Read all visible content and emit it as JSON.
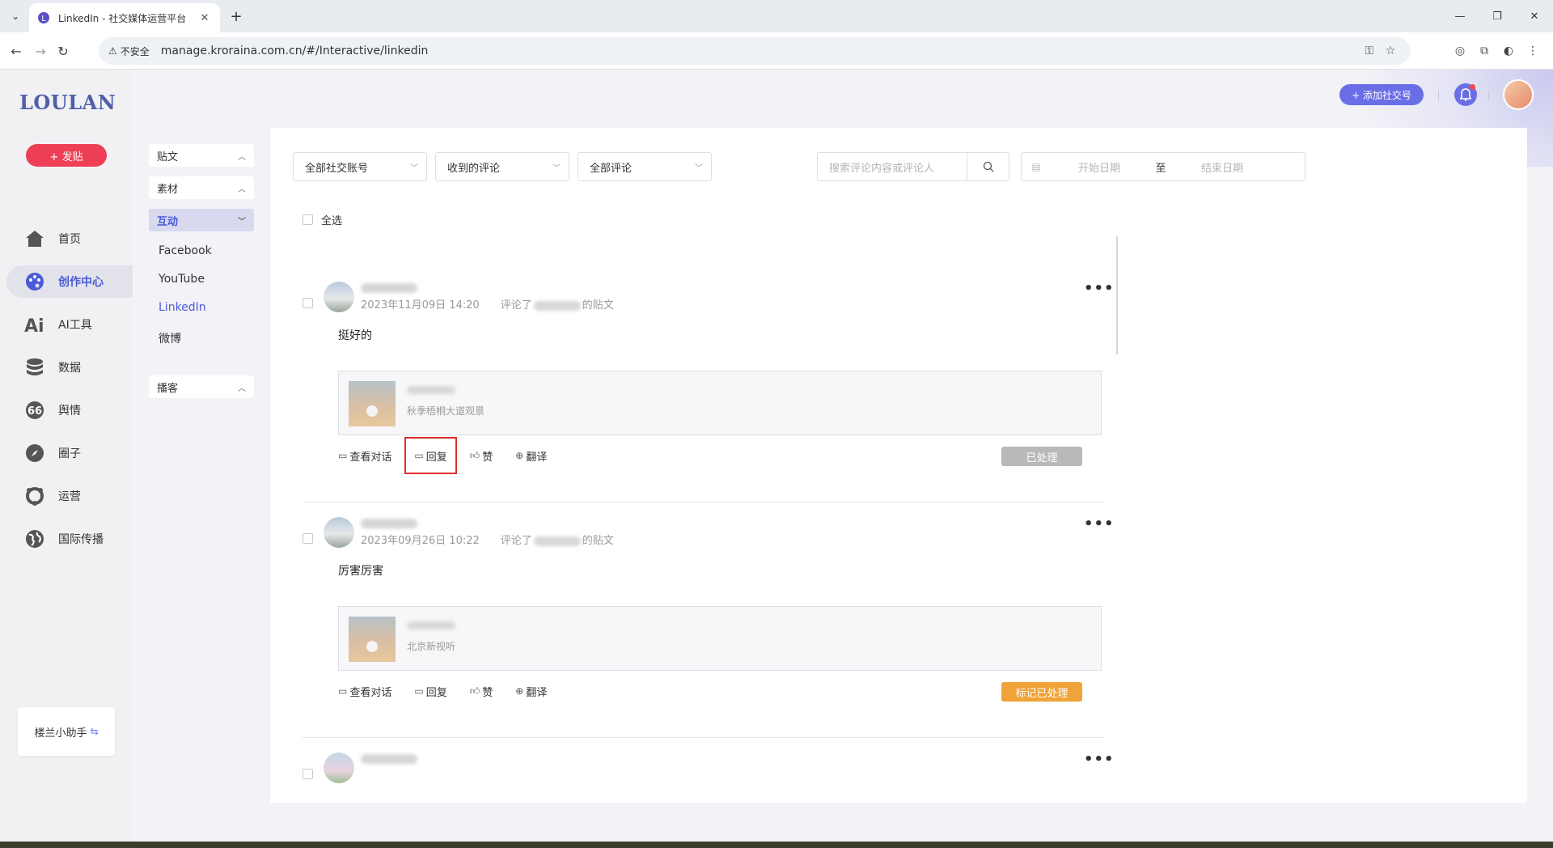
{
  "browser": {
    "tab_title": "LinkedIn - 社交媒体运营平台",
    "security_label": "不安全",
    "url": "manage.kroraina.com.cn/#/Interactive/linkedin"
  },
  "app": {
    "logo": "LOULAN",
    "post_button": "+ 发贴",
    "nav": [
      {
        "label": "首页",
        "icon": "home-icon"
      },
      {
        "label": "创作中心",
        "icon": "palette-icon",
        "active": true
      },
      {
        "label": "AI工具",
        "icon": "ai-icon"
      },
      {
        "label": "数据",
        "icon": "database-icon"
      },
      {
        "label": "舆情",
        "icon": "quote-icon"
      },
      {
        "label": "圈子",
        "icon": "compass-icon"
      },
      {
        "label": "运营",
        "icon": "operations-icon"
      },
      {
        "label": "国际传播",
        "icon": "globe-icon"
      }
    ],
    "assistant": "楼兰小助手"
  },
  "subnav": {
    "groups": [
      "贴文",
      "素材",
      "互动",
      "播客"
    ],
    "items": [
      "Facebook",
      "YouTube",
      "LinkedIn",
      "微博"
    ]
  },
  "header": {
    "add_social": "+ 添加社交号"
  },
  "filters": {
    "account": "全部社交账号",
    "type": "收到的评论",
    "scope": "全部评论",
    "search_placeholder": "搜索评论内容或评论人",
    "start_date": "开始日期",
    "to": "至",
    "end_date": "结束日期"
  },
  "select_all": "全选",
  "comments": [
    {
      "time": "2023年11月09日 14:20",
      "commented": "评论了",
      "post_suffix": "的贴文",
      "text": "挺好的",
      "post_source": "秋季梧桐大道观景",
      "status": "已处理"
    },
    {
      "time": "2023年09月26日 10:22",
      "commented": "评论了",
      "post_suffix": "的贴文",
      "text": "厉害厉害",
      "post_source": "北京新视听",
      "status": "标记已处理"
    }
  ],
  "actions": {
    "view_conversation": "查看对话",
    "reply": "回复",
    "like": "赞",
    "translate": "翻译"
  },
  "colors": {
    "brand": "#4a5ad8",
    "post_button": "#ee3f56",
    "mark_button": "#f0a33a",
    "done_button": "#b9b9b9",
    "highlight": "#e02c2c"
  }
}
